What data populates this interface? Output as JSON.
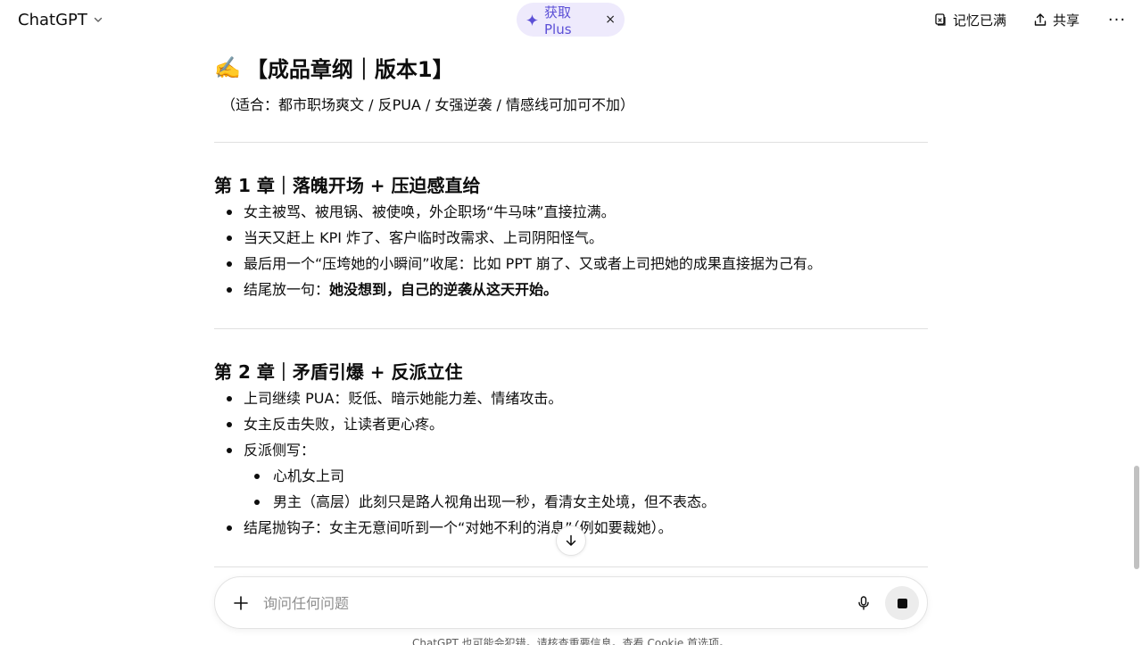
{
  "header": {
    "model_label": "ChatGPT",
    "plus_pill_label": "获取 Plus",
    "plus_close": "×",
    "memory_label": "记忆已满",
    "share_label": "共享",
    "more_label": "···"
  },
  "doc": {
    "title_emoji": "✍️",
    "title": "【成品章纲｜版本1】",
    "subtitle": "（适合：都市职场爽文 / 反PUA / 女强逆袭 / 情感线可加可不加）",
    "chapters": [
      {
        "title": "第 1 章｜落魄开场 + 压迫感直给",
        "items": [
          {
            "text": "女主被骂、被甩锅、被使唤，外企职场“牛马味”直接拉满。"
          },
          {
            "text": "当天又赶上 KPI 炸了、客户临时改需求、上司阴阳怪气。"
          },
          {
            "text": "最后用一个“压垮她的小瞬间”收尾：比如 PPT 崩了、又或者上司把她的成果直接据为己有。"
          },
          {
            "prefix": "结尾放一句：",
            "bold": "她没想到，自己的逆袭从这天开始。"
          }
        ]
      },
      {
        "title": "第 2 章｜矛盾引爆 + 反派立住",
        "items": [
          {
            "text": "上司继续 PUA：贬低、暗示她能力差、情绪攻击。"
          },
          {
            "text": "女主反击失败，让读者更心疼。"
          },
          {
            "text": "反派侧写："
          },
          {
            "text": "心机女上司",
            "sub": true
          },
          {
            "text": "男主（高层）此刻只是路人视角出现一秒，看清女主处境，但不表态。",
            "sub": true
          },
          {
            "text": "结尾抛钩子：女主无意间听到一个“对她不利的消息”（例如要裁她）。"
          }
        ]
      }
    ]
  },
  "composer": {
    "placeholder": "询问任何问题"
  },
  "footer": {
    "disclaimer": "ChatGPT 也可能会犯错。请核查重要信息。查看 Cookie 首选项。"
  },
  "icons": {
    "model_chevron": "chevron-down-icon",
    "plus_spark": "sparkle-icon",
    "memory": "memory-icon",
    "share": "share-upload-icon",
    "more": "more-horizontal-icon",
    "scroll_down": "arrow-down-icon",
    "attach": "plus-icon",
    "mic": "microphone-icon",
    "stop": "stop-icon"
  },
  "colors": {
    "plus_pill_bg": "#eeeafc",
    "plus_pill_text": "#5b4fd6",
    "divider": "#e0e0e0",
    "stop_bg": "#ececec"
  }
}
